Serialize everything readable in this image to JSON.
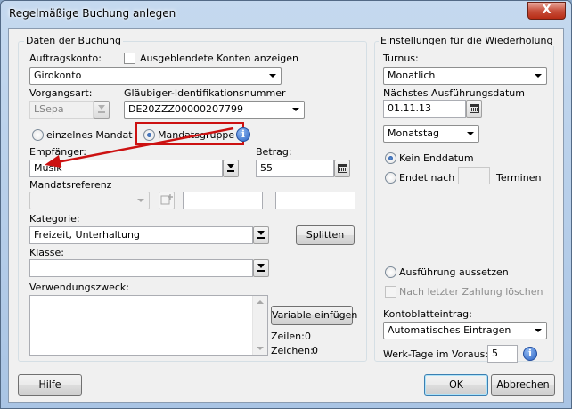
{
  "window": {
    "title": "Regelmäßige Buchung anlegen",
    "close_glyph": "X"
  },
  "left_group": {
    "legend": "Daten der Buchung",
    "auftragskonto_label": "Auftragskonto:",
    "hidden_accounts_label": "Ausgeblendete Konten anzeigen",
    "auftragskonto_value": "Girokonto",
    "vorgangsart_label": "Vorgangsart:",
    "vorgangsart_value": "LSepa",
    "glaeubiger_label": "Gläubiger-Identifikationsnummer",
    "glaeubiger_value": "DE20ZZZ00000207799",
    "einzelnes_mandat_label": "einzelnes Mandat",
    "mandatsgruppe_label": "Mandatsgruppe",
    "empfaenger_label": "Empfänger:",
    "empfaenger_value": "Musik",
    "betrag_label": "Betrag:",
    "betrag_value": "55",
    "mandatsreferenz_label": "Mandatsreferenz",
    "kategorie_label": "Kategorie:",
    "kategorie_value": "Freizeit, Unterhaltung",
    "splitten_label": "Splitten",
    "klasse_label": "Klasse:",
    "klasse_value": "",
    "verwendungszweck_label": "Verwendungszweck:",
    "variable_button_label": "Variable einfügen",
    "zeilen_label": "Zeilen:",
    "zeilen_value": "0",
    "zeichen_label": "Zeichen:",
    "zeichen_value": "0"
  },
  "right_group": {
    "legend": "Einstellungen für die Wiederholung",
    "turnus_label": "Turnus:",
    "turnus_value": "Monatlich",
    "next_date_label": "Nächstes Ausführungsdatum",
    "next_date_value": "01.11.13",
    "monatstag_value": "Monatstag",
    "kein_enddatum_label": "Kein Enddatum",
    "endet_nach_label": "Endet nach",
    "endet_nach_value": "",
    "terminen_label": "Terminen",
    "aussetzen_label": "Ausführung aussetzen",
    "nach_letzter_label": "Nach letzter Zahlung löschen",
    "kontoblatt_label": "Kontoblatteintrag:",
    "kontoblatt_value": "Automatisches Eintragen",
    "werktage_label": "Werk-Tage im Voraus:",
    "werktage_value": "5"
  },
  "footer": {
    "hilfe_label": "Hilfe",
    "ok_label": "OK",
    "abbrechen_label": "Abbrechen"
  },
  "colors": {
    "annotation_red": "#cc1111",
    "info_blue": "#2c64c4"
  },
  "icons": {
    "info": "info-icon",
    "download": "download-arrow-icon",
    "calendar": "calendar-icon",
    "add": "add-icon",
    "info_glyph": "i"
  }
}
